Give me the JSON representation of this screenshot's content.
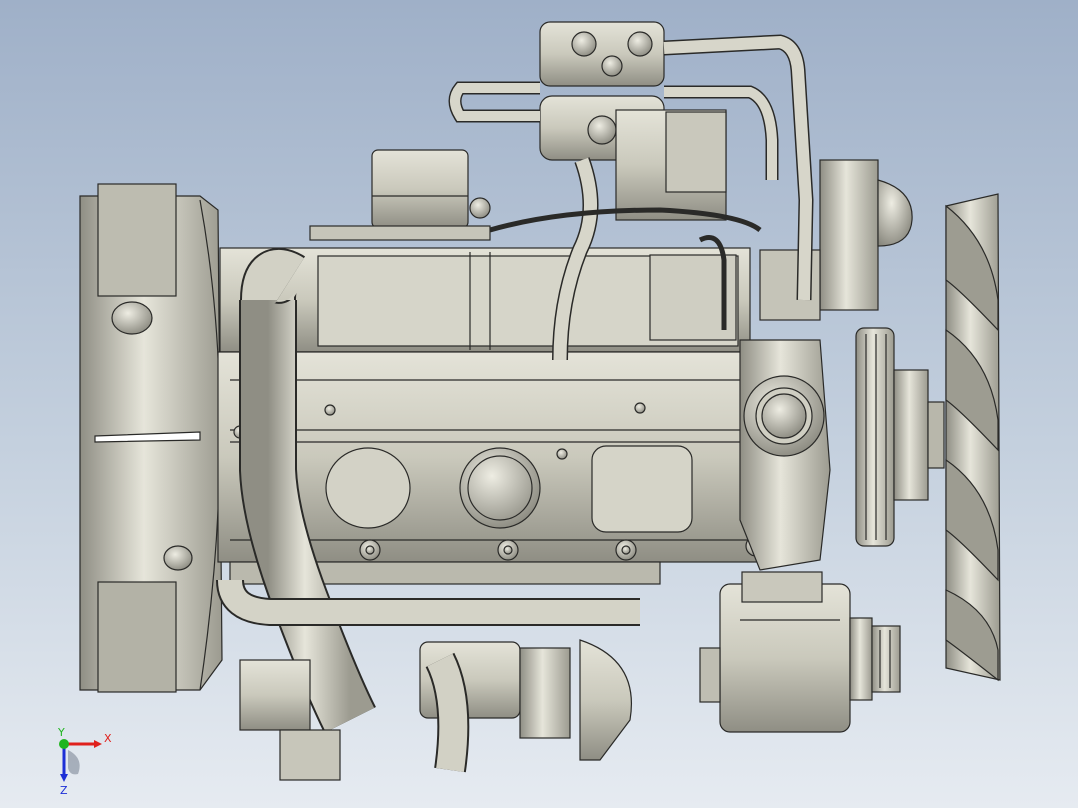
{
  "viewport": {
    "background_top": "#9fb0c8",
    "background_bottom": "#e6ebf1"
  },
  "model": {
    "part_color": "#cfcec1",
    "edge_color": "#2a2a28",
    "shade_color": "#8f8e84"
  },
  "triad": {
    "x_label": "X",
    "y_label": "Y",
    "z_label": "Z",
    "x_color": "#e0201c",
    "y_color": "#1fb51f",
    "z_color": "#1d2fd6"
  }
}
